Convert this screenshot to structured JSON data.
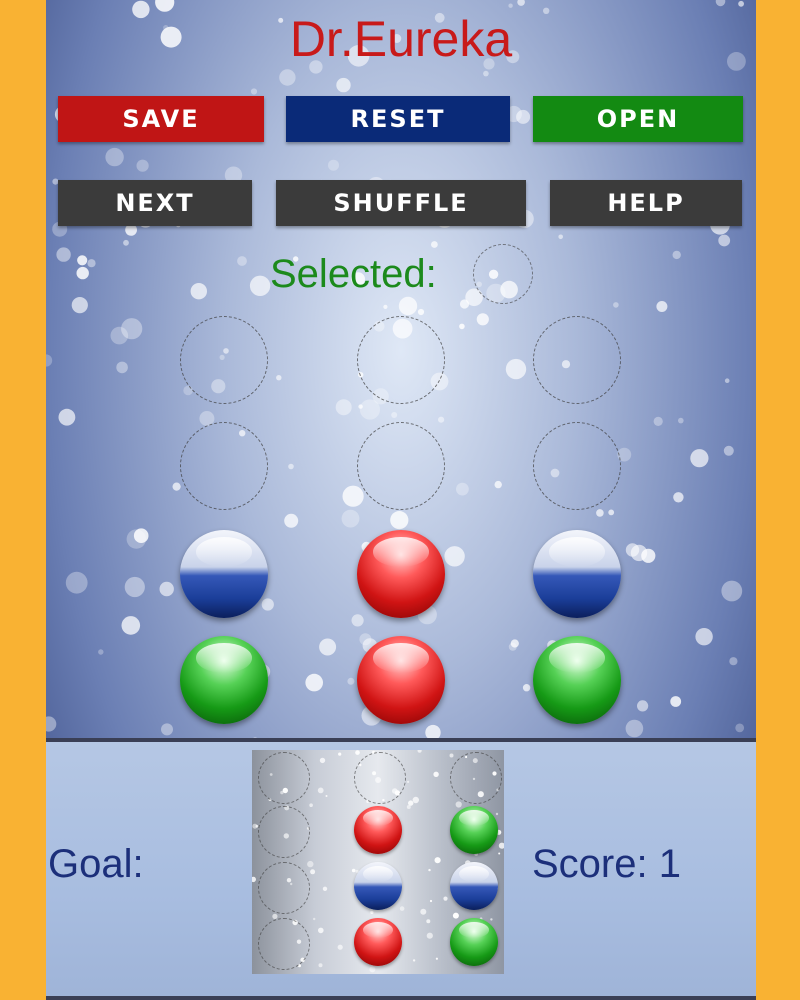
{
  "app": {
    "title": "Dr.Eureka"
  },
  "buttons": {
    "save": "SAVE",
    "reset": "RESET",
    "open": "OPEN",
    "next": "NEXT",
    "shuffle": "SHUFFLE",
    "help": "HELP"
  },
  "selected": {
    "label": "Selected:",
    "ball": null
  },
  "board": {
    "columns": 3,
    "rows": [
      [
        "empty",
        "empty",
        "empty"
      ],
      [
        "empty",
        "empty",
        "empty"
      ],
      [
        "blue",
        "red",
        "blue"
      ],
      [
        "green",
        "red",
        "green"
      ]
    ]
  },
  "goal": {
    "label": "Goal:",
    "rows": [
      [
        "empty",
        "empty",
        "empty"
      ],
      [
        "empty",
        "red",
        "green"
      ],
      [
        "empty",
        "blue",
        "blue"
      ],
      [
        "empty",
        "red",
        "green"
      ]
    ]
  },
  "score": {
    "label": "Score: 1"
  },
  "colors": {
    "title": "#c81a1a",
    "save": "#c01515",
    "reset": "#0a2a78",
    "open": "#138a12",
    "dark_button": "#3b3b3b",
    "selected_label": "#1c8a1c",
    "bottom_text": "#1c2f7a",
    "frame": "#f9b233"
  }
}
